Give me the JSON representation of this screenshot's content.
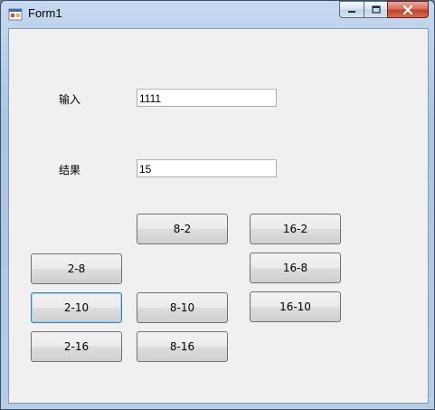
{
  "window": {
    "title": "Form1"
  },
  "form": {
    "input_label": "输入",
    "input_value": "1111",
    "result_label": "结果",
    "result_value": "15"
  },
  "buttons": {
    "b8_2": "8-2",
    "b16_2": "16-2",
    "b2_8": "2-8",
    "b16_8": "16-8",
    "b2_10": "2-10",
    "b8_10": "8-10",
    "b16_10": "16-10",
    "b2_16": "2-16",
    "b8_16": "8-16"
  },
  "icons": {
    "app": "form-app-icon",
    "minimize": "minimize-icon",
    "maximize": "maximize-icon",
    "close": "close-icon"
  }
}
